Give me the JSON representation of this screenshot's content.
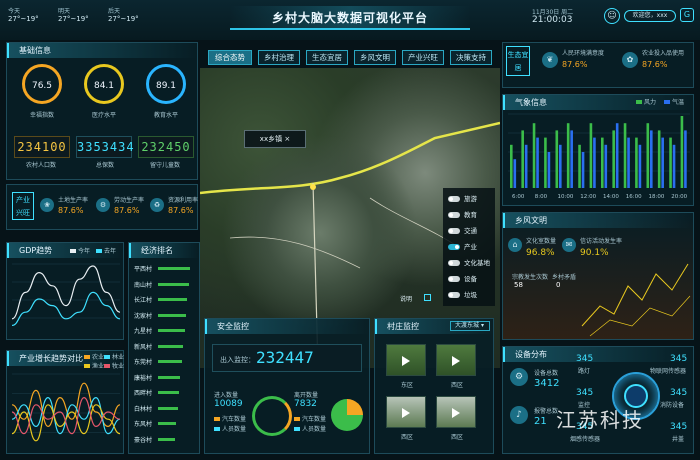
{
  "header": {
    "title": "乡村大脑大数据可视化平台",
    "weather": [
      {
        "day": "今天",
        "temp": "27°~19°"
      },
      {
        "day": "明天",
        "temp": "27°~19°"
      },
      {
        "day": "后天",
        "temp": "27°~19°"
      }
    ],
    "date": "11月30日 周二",
    "time": "21:00:03",
    "user": "欢迎您，xxx"
  },
  "tabs": [
    "综合态势",
    "乡村治理",
    "生态宜居",
    "乡风文明",
    "产业兴旺",
    "决策支持"
  ],
  "basic": {
    "title": "基础信息",
    "rings": [
      {
        "value": "76.5",
        "label": "幸福指数",
        "color": "#f5a623"
      },
      {
        "value": "84.1",
        "label": "医疗水平",
        "color": "#e8c81f"
      },
      {
        "value": "89.1",
        "label": "教育水平",
        "color": "#2ab5ff"
      }
    ],
    "counters": [
      {
        "value": "234100",
        "label": "农村人口数",
        "color": "#f5c542"
      },
      {
        "value": "3353434",
        "label": "总保数",
        "color": "#3fe0ff"
      },
      {
        "value": "232450",
        "label": "留守儿童数",
        "color": "#5fd06a"
      }
    ]
  },
  "industry": {
    "badge": "产业兴旺",
    "items": [
      {
        "label": "土地生产率",
        "value": "87.6%"
      },
      {
        "label": "劳动生产率",
        "value": "87.6%"
      },
      {
        "label": "资源利用率",
        "value": "87.6%"
      }
    ]
  },
  "eco": {
    "badge": "生态宜居",
    "items": [
      {
        "label": "人民环境满意度",
        "value": "87.6%"
      },
      {
        "label": "农业投入品使用",
        "value": "87.6%"
      }
    ]
  },
  "gdp": {
    "title": "GDP趋势",
    "legend": [
      "今年",
      "去年"
    ]
  },
  "growth": {
    "title": "产业增长趋势对比",
    "legend": [
      "农业",
      "林业",
      "渔业",
      "牧业"
    ]
  },
  "ranking": {
    "title": "经济排名",
    "items": [
      {
        "name": "平西村",
        "value": 0.95
      },
      {
        "name": "南山村",
        "value": 0.9
      },
      {
        "name": "长江村",
        "value": 0.86
      },
      {
        "name": "沈家村",
        "value": 0.82
      },
      {
        "name": "九星村",
        "value": 0.78
      },
      {
        "name": "新风村",
        "value": 0.74
      },
      {
        "name": "东莞村",
        "value": 0.7
      },
      {
        "name": "康裕村",
        "value": 0.66
      },
      {
        "name": "西畔村",
        "value": 0.62
      },
      {
        "name": "白林村",
        "value": 0.58
      },
      {
        "name": "东风村",
        "value": 0.54
      },
      {
        "name": "豪谷村",
        "value": 0.5
      }
    ]
  },
  "map": {
    "popup": "xx乡镇",
    "layers": [
      {
        "label": "旅游",
        "on": false
      },
      {
        "label": "教育",
        "on": false
      },
      {
        "label": "交通",
        "on": false
      },
      {
        "label": "产业",
        "on": true
      },
      {
        "label": "文化基地",
        "on": false
      },
      {
        "label": "设备",
        "on": false
      },
      {
        "label": "垃圾",
        "on": false
      }
    ],
    "legend_label": "说明"
  },
  "security": {
    "title": "安全监控",
    "entry_label": "出入监控：",
    "entry_value": "232447",
    "in_label": "进入数量",
    "in_value": "10089",
    "out_label": "离开数量",
    "out_value": "7832",
    "legend": [
      "汽车数量",
      "人员数量"
    ]
  },
  "village": {
    "title": "村庄监控",
    "select": "大渡东城",
    "thumbs": [
      "东区",
      "西区",
      "西区",
      "西区"
    ]
  },
  "weather": {
    "title": "气象信息",
    "legend": [
      "风力",
      "气温"
    ]
  },
  "culture": {
    "title": "乡风文明",
    "items": [
      {
        "label": "文化室数量",
        "value": "96.8%"
      },
      {
        "label": "信访活动发生率",
        "value": "90.1%"
      }
    ],
    "sub": [
      {
        "label": "宗教发生次数",
        "value": "58"
      },
      {
        "label": "乡村矛盾",
        "value": "0"
      }
    ]
  },
  "devices": {
    "title": "设备分布",
    "total_label": "设备总数",
    "total": "3412",
    "alarm_label": "报警总数",
    "alarm": "21",
    "nodes": [
      {
        "value": "345",
        "label": "路灯"
      },
      {
        "value": "345",
        "label": "物联网传感器"
      },
      {
        "value": "345",
        "label": "监控"
      },
      {
        "value": "345",
        "label": "消防设备"
      },
      {
        "value": "345",
        "label": "烟感传感器"
      },
      {
        "value": "345",
        "label": "井盖"
      }
    ]
  },
  "watermark": "江苏科技",
  "chart_data": [
    {
      "type": "line",
      "title": "GDP趋势",
      "series": [
        {
          "name": "今年",
          "values": [
            2,
            6,
            9,
            7,
            4,
            8,
            10,
            6,
            3
          ]
        },
        {
          "name": "去年",
          "values": [
            1,
            3,
            5,
            4,
            2,
            3,
            6,
            4,
            2
          ]
        }
      ]
    },
    {
      "type": "line",
      "title": "产业增长趋势对比",
      "series": [
        {
          "name": "农业",
          "values": [
            6,
            4,
            8,
            3,
            7,
            4,
            9,
            5,
            3,
            6
          ]
        },
        {
          "name": "林业",
          "values": [
            4,
            6,
            3,
            7,
            2,
            6,
            4,
            7,
            2,
            4
          ]
        },
        {
          "name": "渔业",
          "values": [
            2,
            5,
            1,
            6,
            3,
            5,
            2,
            6,
            4,
            2
          ]
        },
        {
          "name": "牧业",
          "values": [
            5,
            2,
            6,
            4,
            5,
            2,
            7,
            3,
            5,
            4
          ]
        }
      ]
    },
    {
      "type": "bar",
      "title": "气象信息",
      "categories": [
        "6:00",
        "8:00",
        "10:00",
        "12:00",
        "14:00",
        "16:00",
        "18:00",
        "20:00"
      ],
      "series": [
        {
          "name": "风力",
          "values": [
            6,
            8,
            9,
            7,
            8,
            9,
            6,
            9,
            7,
            8,
            9,
            7,
            9,
            8,
            7,
            10
          ]
        },
        {
          "name": "气温",
          "values": [
            4,
            6,
            7,
            5,
            6,
            8,
            5,
            7,
            6,
            9,
            7,
            6,
            8,
            7,
            6,
            8
          ]
        }
      ]
    },
    {
      "type": "pie",
      "title": "安全监控",
      "categories": [
        "汽车数量",
        "人员数量"
      ],
      "values": [
        25,
        75
      ]
    }
  ]
}
